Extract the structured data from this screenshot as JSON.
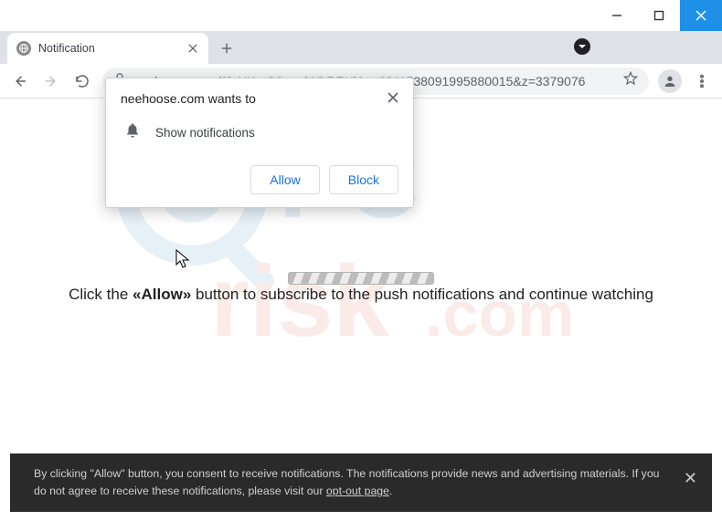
{
  "window": {
    "tab_title": "Notification"
  },
  "toolbar": {
    "url_domain": "neehoose.com",
    "url_path": "/?l=XKmG8ooqkNkREHl&s=3211738091995880015&z=3379076"
  },
  "permission": {
    "title": "neehoose.com wants to",
    "item": "Show notifications",
    "allow": "Allow",
    "block": "Block"
  },
  "page": {
    "watermark": "PCrisk.com",
    "instruction_pre": "Click the ",
    "instruction_lq": "«",
    "instruction_bold": "Allow",
    "instruction_rq": "»",
    "instruction_post": " button to subscribe to the push notifications and continue watching"
  },
  "consent": {
    "text_a": "By clicking \"Allow\" button, you consent to receive notifications. The notifications provide news and advertising materials. If you do not agree to receive these notifications, please visit our ",
    "link": "opt-out page",
    "text_b": "."
  }
}
